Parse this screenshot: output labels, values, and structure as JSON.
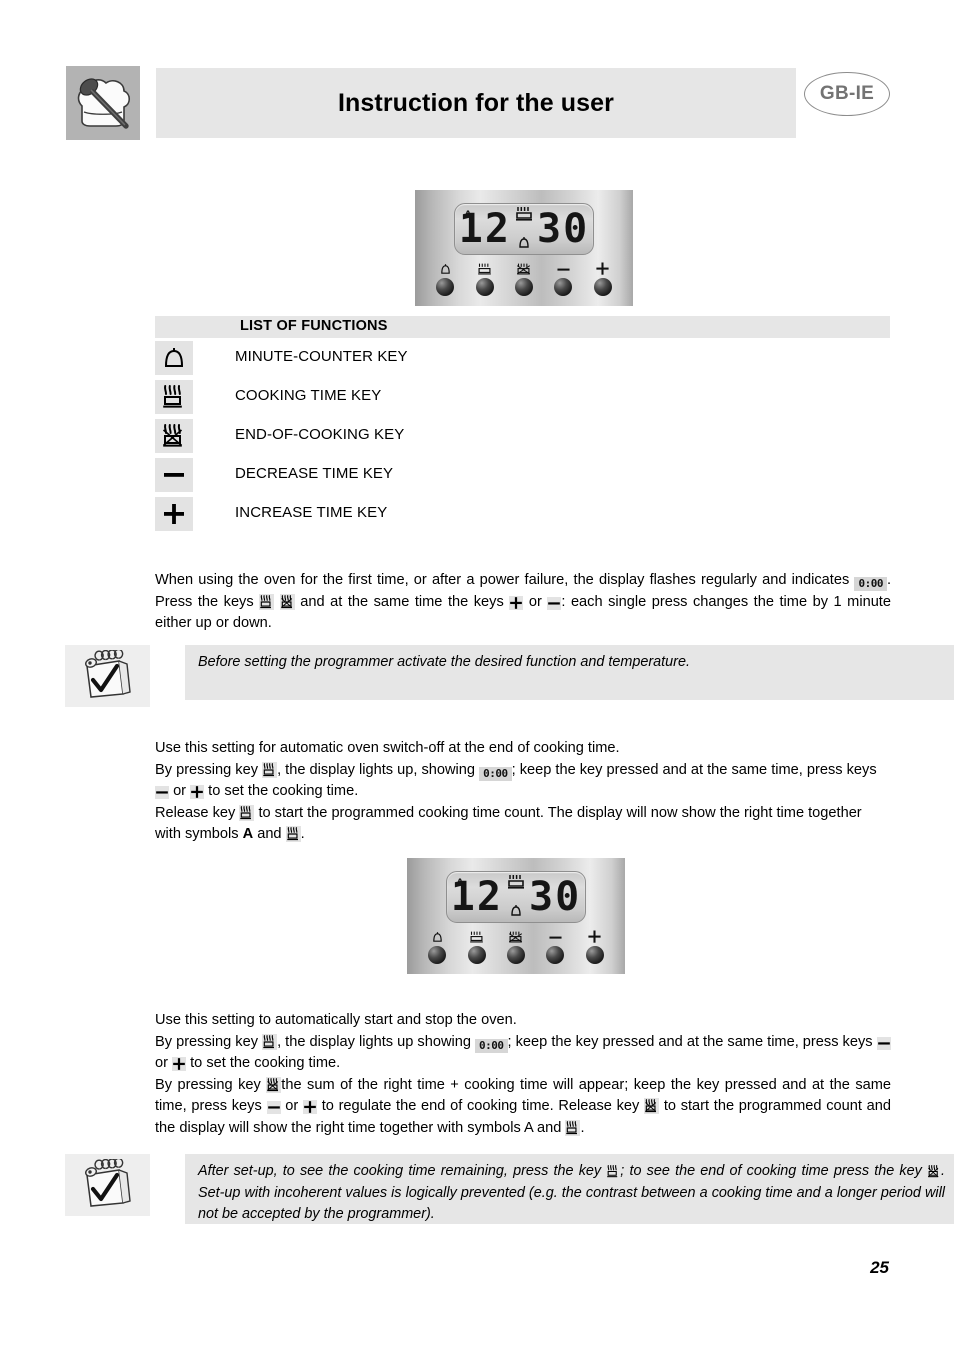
{
  "header": {
    "title": "Instruction for the user",
    "language_badge": "GB-IE",
    "chef_icon": "chef-hat-spoon-icon"
  },
  "programmer_display": {
    "indicator_a": "A",
    "time": "12 30",
    "time_readable": "12:30",
    "top_symbol": "cooking-pot-icon",
    "bottom_symbol": "bell-icon",
    "keys": [
      {
        "icon": "bell-icon",
        "name": "minute-counter"
      },
      {
        "icon": "cooking-pot-icon",
        "name": "cooking-time"
      },
      {
        "icon": "cooking-pot-crossed-icon",
        "name": "end-of-cooking"
      },
      {
        "icon": "minus-icon",
        "name": "decrease-time"
      },
      {
        "icon": "plus-icon",
        "name": "increase-time"
      }
    ]
  },
  "list_of_functions": {
    "heading": "LIST OF FUNCTIONS",
    "items": [
      {
        "icon": "bell-icon",
        "label": "MINUTE-COUNTER KEY"
      },
      {
        "icon": "cooking-pot-icon",
        "label": "COOKING TIME KEY"
      },
      {
        "icon": "cooking-pot-crossed-icon",
        "label": "END-OF-COOKING KEY"
      },
      {
        "icon": "minus-icon",
        "label": "DECREASE TIME KEY"
      },
      {
        "icon": "plus-icon",
        "label": "INCREASE TIME KEY"
      }
    ]
  },
  "intro": {
    "part1": "When using the oven for the first time, or after a power failure, the display flashes regularly and indicates",
    "lcd_value": "0:00",
    "part2": ". Press the keys",
    "part3": "and at the same time the keys",
    "part4": "or",
    "part5": ": each single press changes the time by 1 minute either up or down."
  },
  "note_1": {
    "icon": "notepad-check-icon",
    "text": "Before setting the programmer activate the desired function and temperature."
  },
  "section_cooking_time": {
    "line1": "Use this setting for automatic oven switch-off at the end of cooking time.",
    "line2_a": "By pressing key",
    "line2_b": ", the display lights up, showing",
    "lcd_value": "0:00",
    "line2_c": "; keep the key pressed and at the same time, press keys",
    "line2_d": "or",
    "line2_e": "to set the cooking time.",
    "line3_a": "Release key",
    "line3_b": "to start the programmed cooking time count. The display will now show the right time together with symbols",
    "symbol_a": "A",
    "line3_c": "and",
    "line3_d": "."
  },
  "section_auto_start_stop": {
    "line1": "Use this setting to automatically start and stop the oven.",
    "line2_a": "By pressing key",
    "line2_b": ", the display lights up showing",
    "lcd_value": "0:00",
    "line2_c": "; keep the key pressed and at the same time, press keys",
    "line2_d": "or",
    "line2_e": "to set the cooking time.",
    "line3_a": "By pressing key",
    "line3_b": "the sum of the right time + cooking time will appear; keep the key pressed and at the same time, press keys",
    "line3_c": "or",
    "line3_d": "to regulate the end of cooking time. Release key",
    "line3_e": "to start the programmed count and the display will show the right time together with symbols A and",
    "line3_f": "."
  },
  "note_2": {
    "icon": "notepad-check-icon",
    "text_a": "After set-up, to see the cooking time remaining, press the key",
    "text_b": "; to see the end of cooking time press the key",
    "text_c": ". Set-up with incoherent values is logically prevented (e.g. the contrast between a cooking time and a longer period will not be accepted by the programmer)."
  },
  "page_number": "25",
  "colors": {
    "header_bar": "#e6e6e6",
    "chef_badge_bg": "#b3b3b3",
    "badge_outline": "#8c8c8c",
    "icon_chip_bg": "#e3e3e3",
    "note_bg": "#e6e6e6",
    "lcd_chip_bg": "#d6d6d6"
  }
}
